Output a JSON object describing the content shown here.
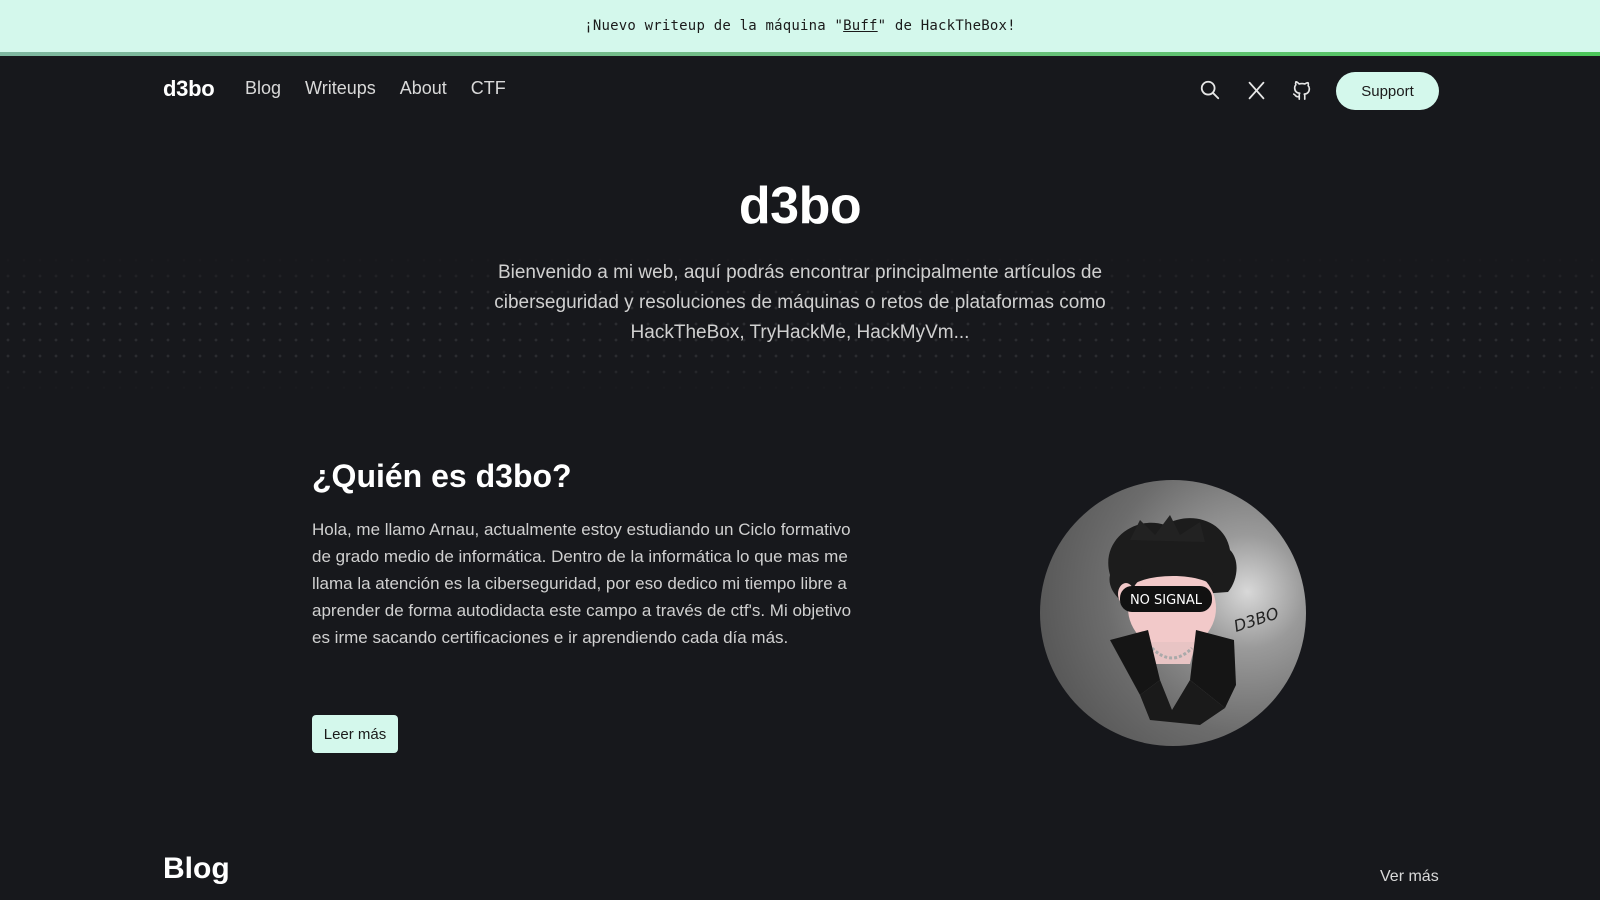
{
  "banner": {
    "prefix": "¡Nuevo writeup de la máquina \"",
    "link": "Buff",
    "suffix": "\" de HackTheBox!"
  },
  "nav": {
    "logo": "d3bo",
    "links": [
      "Blog",
      "Writeups",
      "About",
      "CTF"
    ],
    "icons": [
      "search-icon",
      "x-icon",
      "github-icon"
    ],
    "support_label": "Support"
  },
  "hero": {
    "title": "d3bo",
    "text": "Bienvenido a mi web, aquí podrás encontrar principalmente artículos de ciberseguridad y resoluciones de máquinas o retos de plataformas como HackTheBox, TryHackMe, HackMyVm..."
  },
  "about": {
    "title": "¿Quién es d3bo?",
    "text": "Hola, me llamo Arnau, actualmente estoy estudiando un Ciclo formativo de grado medio de informática. Dentro de la informática lo que mas me llama la atención es la ciberseguridad, por eso dedico mi tiempo libre a aprender de forma autodidacta este campo a través de ctf's. Mi objetivo es irme sacando certificaciones e ir aprendiendo cada día más.",
    "button": "Leer más",
    "avatar_text": "NO SIGNAL",
    "avatar_signature": "D3BO"
  },
  "blog": {
    "title": "Blog",
    "see_more": "Ver más"
  },
  "colors": {
    "background": "#17181c",
    "accent": "#d4f8ec",
    "banner_line": "#4bc75a"
  }
}
